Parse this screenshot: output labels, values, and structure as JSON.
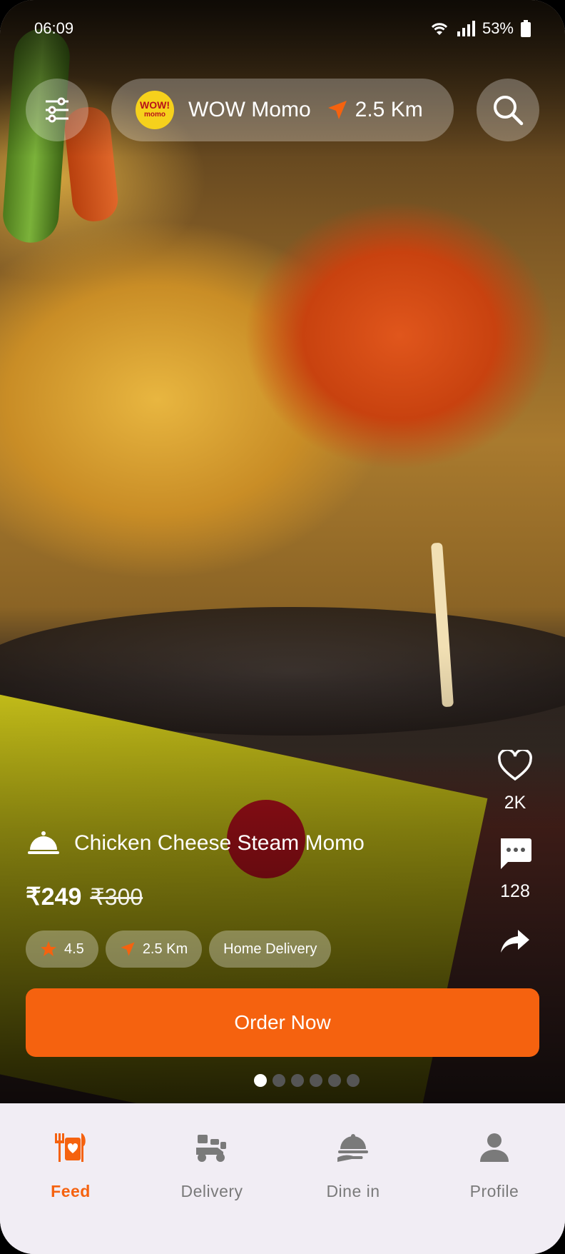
{
  "status_bar": {
    "time": "06:09",
    "battery": "53%"
  },
  "header": {
    "store_logo_top": "WOW!",
    "store_logo_bottom": "momo",
    "store_name": "WOW Momo",
    "distance": "2.5 Km"
  },
  "actions": {
    "likes": "2K",
    "comments": "128"
  },
  "product": {
    "name": "Chicken Cheese Steam Momo",
    "price": "₹249",
    "old_price": "₹300",
    "rating": "4.5",
    "distance": "2.5 Km",
    "delivery": "Home Delivery"
  },
  "order_label": "Order Now",
  "pager": {
    "count": 6,
    "active": 0
  },
  "nav": {
    "items": [
      {
        "label": "Feed",
        "icon": "feed-icon",
        "active": true
      },
      {
        "label": "Delivery",
        "icon": "delivery-icon",
        "active": false
      },
      {
        "label": "Dine in",
        "icon": "dine-in-icon",
        "active": false
      },
      {
        "label": "Profile",
        "icon": "profile-icon",
        "active": false
      }
    ]
  },
  "colors": {
    "accent": "#f5620f",
    "nav_bg": "#f1edf4",
    "logo_yellow": "#f6d11c"
  }
}
